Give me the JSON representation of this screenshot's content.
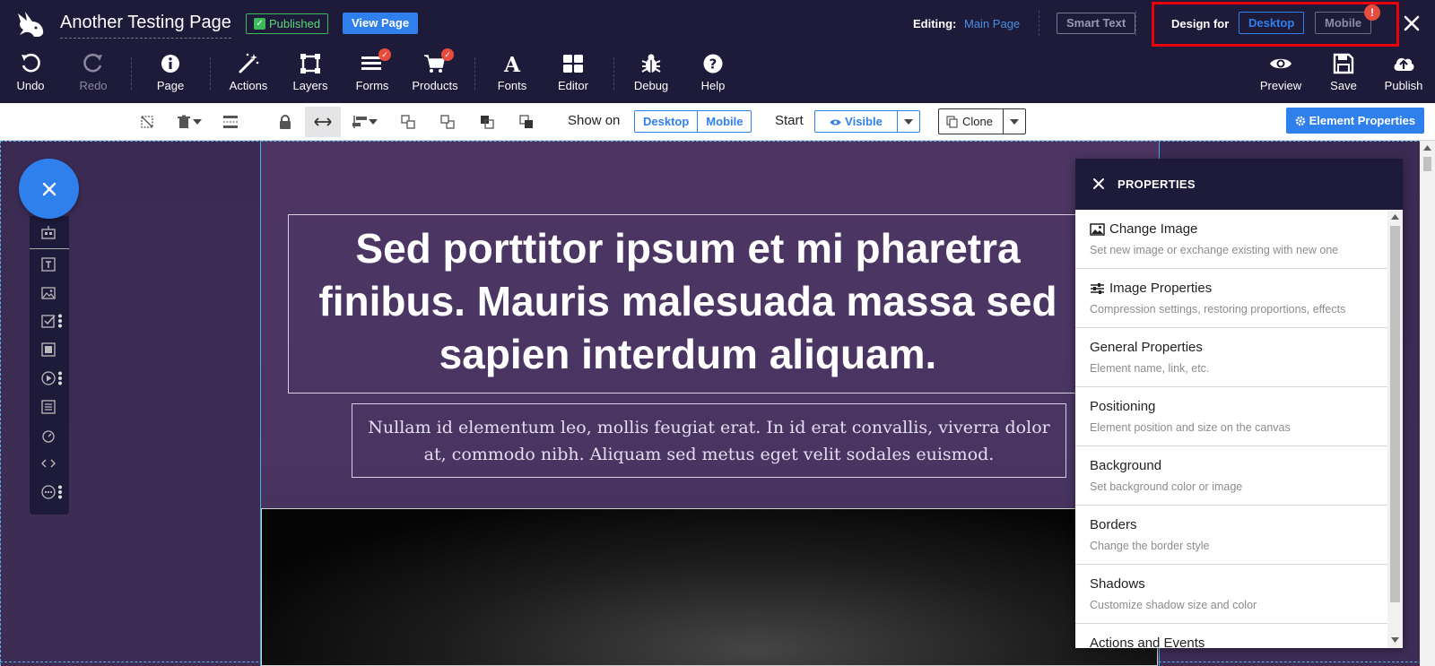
{
  "header": {
    "page_title": "Another Testing Page",
    "published_badge": "Published",
    "view_page_label": "View Page",
    "editing_label": "Editing:",
    "editing_value": "Main Page",
    "smart_text_label": "Smart Text",
    "design_for_label": "Design for",
    "design_desktop_label": "Desktop",
    "design_mobile_label": "Mobile",
    "alert_glyph": "!"
  },
  "toolbar": {
    "undo": "Undo",
    "redo": "Redo",
    "page": "Page",
    "actions": "Actions",
    "layers": "Layers",
    "forms": "Forms",
    "products": "Products",
    "fonts": "Fonts",
    "editor": "Editor",
    "debug": "Debug",
    "help": "Help",
    "preview": "Preview",
    "save": "Save",
    "publish": "Publish"
  },
  "toolbar2": {
    "show_on_label": "Show on",
    "show_desktop": "Desktop",
    "show_mobile": "Mobile",
    "start_label": "Start",
    "visible_label": "Visible",
    "clone_label": "Clone",
    "element_properties_label": "Element Properties"
  },
  "canvas": {
    "headline": "Sed porttitor ipsum et mi pharetra finibus. Mauris malesuada massa sed sapien interdum aliquam.",
    "subtext": "Nullam id elementum leo, mollis feugiat erat. In id erat convallis, viverra dolor at, commodo nibh. Aliquam sed metus eget velit sodales euismod."
  },
  "properties": {
    "title": "PROPERTIES",
    "items": [
      {
        "title": "Change Image",
        "desc": "Set new image or exchange existing with new one",
        "icon": "image-icon"
      },
      {
        "title": "Image Properties",
        "desc": "Compression settings, restoring proportions, effects",
        "icon": "sliders-icon"
      },
      {
        "title": "General Properties",
        "desc": "Element name, link, etc."
      },
      {
        "title": "Positioning",
        "desc": "Element position and size on the canvas"
      },
      {
        "title": "Background",
        "desc": "Set background color or image"
      },
      {
        "title": "Borders",
        "desc": "Change the border style"
      },
      {
        "title": "Shadows",
        "desc": "Customize shadow size and color"
      },
      {
        "title": "Actions and Events",
        "desc": ""
      }
    ]
  },
  "colors": {
    "topbar_bg": "#1d1a3a",
    "accent_blue": "#2f80ed",
    "published_green": "#3dbb5c",
    "highlight_red": "#e8000b",
    "canvas_bg": "#3b2b52"
  }
}
